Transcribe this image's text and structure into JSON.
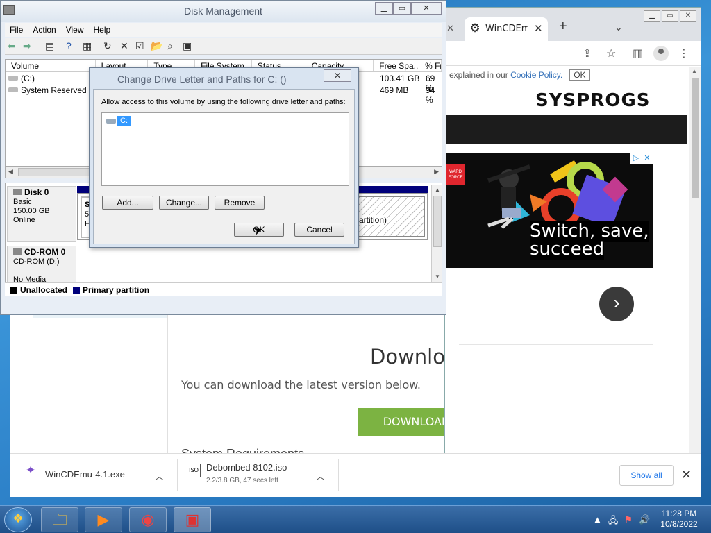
{
  "chrome": {
    "tab_title": "WinCDEmu - CD/DVD/BD emulator",
    "new_tab": "+",
    "cookie_text": "explained in our ",
    "cookie_link": "Cookie Policy.",
    "cookie_ok": "OK",
    "logo": "SYSPROGS",
    "ad_line1": "Switch, save,",
    "ad_line2": "succeed",
    "ad_badge": "WARD FORCE",
    "next_arrow": "›",
    "download_title": "Download",
    "download_sub": "You can download the latest version below.",
    "download_button": "DOWNLOAD",
    "partial_heading": "System Requirements"
  },
  "downloads": {
    "item1": {
      "name": "WinCDEmu-4.1.exe"
    },
    "item2": {
      "name": "Debombed 8102.iso",
      "meta": "2.2/3.8 GB, 47 secs left"
    },
    "show_all": "Show all",
    "close": "✕"
  },
  "diskmgmt": {
    "title": "Disk Management",
    "menu": [
      "File",
      "Action",
      "View",
      "Help"
    ],
    "columns": [
      "Volume",
      "Layout",
      "Type",
      "File System",
      "Status",
      "Capacity",
      "Free Spa...",
      "% Fr"
    ],
    "volumes": [
      {
        "name": "(C:)",
        "free": "103.41 GB",
        "pct": "69 %"
      },
      {
        "name": "System Reserved",
        "free": "469 MB",
        "pct": "94 %"
      }
    ],
    "disk0": {
      "name": "Disk 0",
      "type": "Basic",
      "size": "150.00 GB",
      "status": "Online"
    },
    "sys_partition": {
      "l1": "Sy",
      "l2": "50",
      "l3": "He"
    },
    "c_partition_text": "Partition)",
    "cdrom": {
      "name": "CD-ROM 0",
      "drive": "CD-ROM (D:)",
      "media": "No Media"
    },
    "legend": {
      "unallocated": "Unallocated",
      "primary": "Primary partition"
    },
    "colors": {
      "unallocated": "#000000",
      "primary": "#00007b"
    }
  },
  "dialog": {
    "title": "Change Drive Letter and Paths for C: ()",
    "close": "✕",
    "instruction": "Allow access to this volume by using the following drive letter and paths:",
    "path_item": "C:",
    "add": "Add...",
    "change": "Change...",
    "remove": "Remove",
    "ok": "OK",
    "cancel": "Cancel"
  },
  "taskbar": {
    "time": "11:28 PM",
    "date": "10/8/2022"
  }
}
